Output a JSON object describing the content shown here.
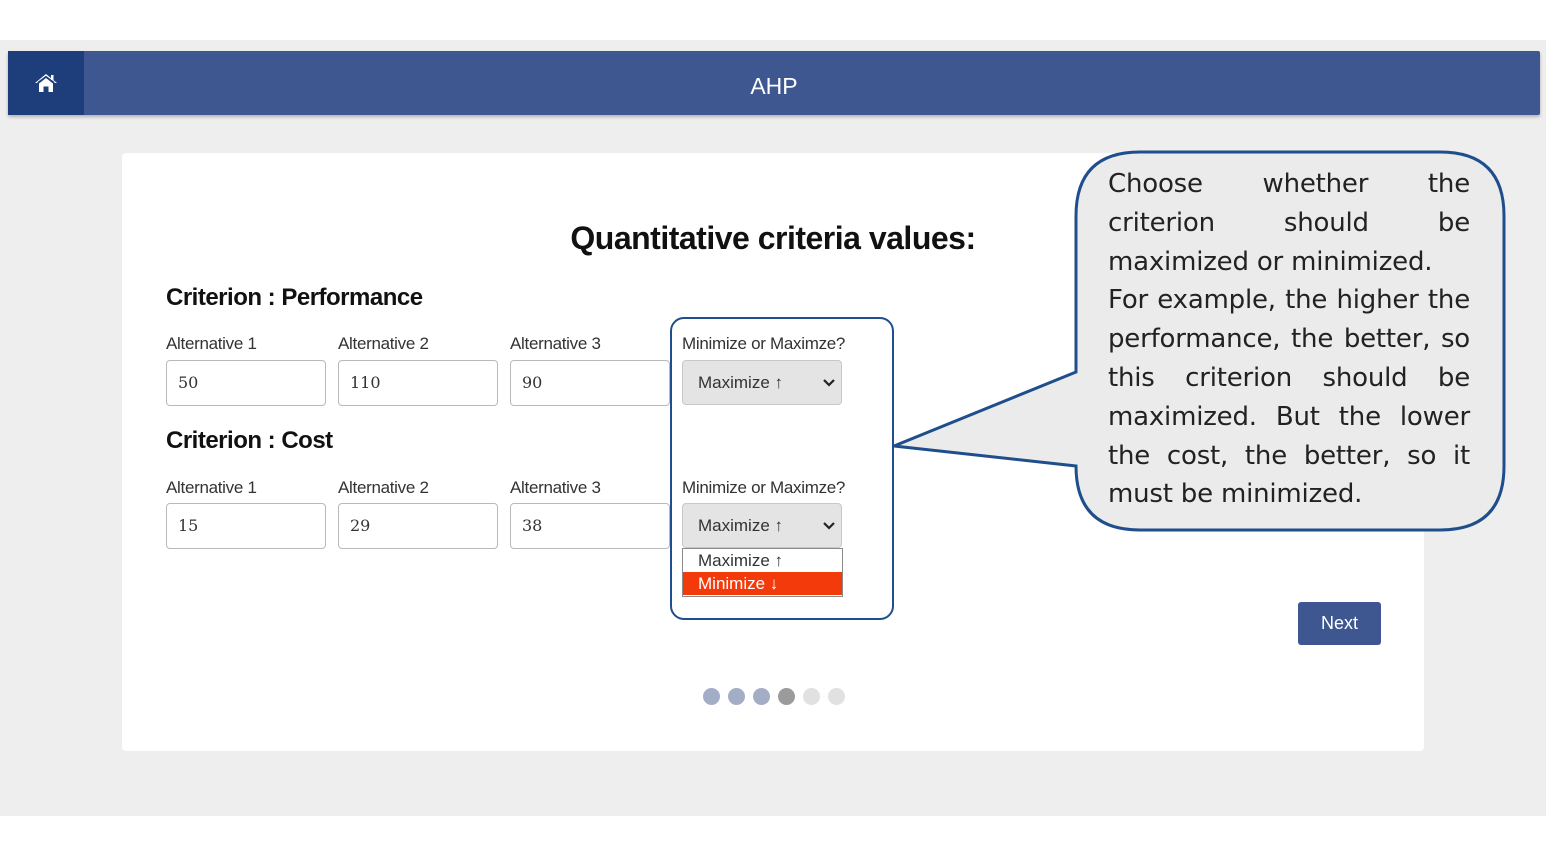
{
  "header": {
    "title": "AHP",
    "home_icon": "home-icon"
  },
  "main": {
    "title": "Quantitative criteria values:",
    "criteria": [
      {
        "title": "Criterion : Performance",
        "alternatives": [
          {
            "label": "Alternative 1",
            "value": "50"
          },
          {
            "label": "Alternative 2",
            "value": "110"
          },
          {
            "label": "Alternative 3",
            "value": "90"
          }
        ],
        "direction_label": "Minimize or Maximze?",
        "direction_value": "Maximize ↑"
      },
      {
        "title": "Criterion : Cost",
        "alternatives": [
          {
            "label": "Alternative 1",
            "value": "15"
          },
          {
            "label": "Alternative 2",
            "value": "29"
          },
          {
            "label": "Alternative 3",
            "value": "38"
          }
        ],
        "direction_label": "Minimize or Maximze?",
        "direction_value": "Maximize ↑"
      }
    ],
    "dropdown_options": [
      {
        "label": "Maximize ↑",
        "highlighted": false
      },
      {
        "label": "Minimize ↓",
        "highlighted": true
      }
    ],
    "next_label": "Next",
    "pager": {
      "total": 6,
      "active": 4
    }
  },
  "callout": {
    "paragraphs": [
      "Choose whether the criterion should be maximized or minimized.",
      "For example, the higher the performance, the better, so this criterion should be maximized. But the lower the cost, the better, so it must be minimized."
    ]
  },
  "colors": {
    "navbar": "#3e5790",
    "home_button": "#1e3d7b",
    "highlight_outline": "#1f4e8c",
    "option_selected": "#f33a0a",
    "dot_filled": "#a3aec6",
    "dot_current": "#9b9b9b",
    "dot_empty": "#e1e1e1"
  }
}
